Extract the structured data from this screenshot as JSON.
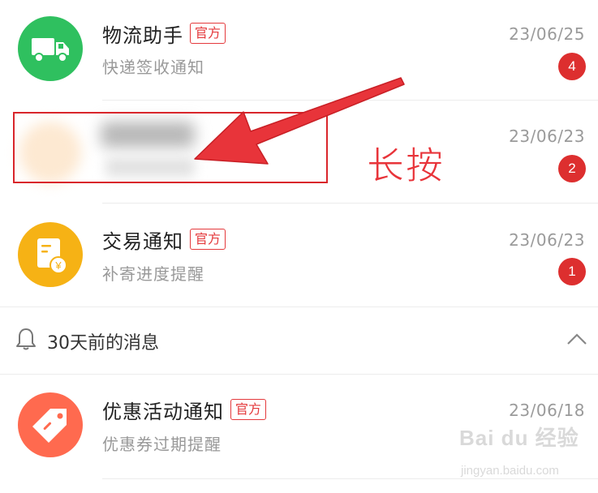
{
  "conversations": [
    {
      "title": "物流助手",
      "tag": "官方",
      "subtitle": "快递签收通知",
      "date": "23/06/25",
      "unread": "4",
      "avatar_icon": "truck-icon",
      "avatar_color": "#2fc05f"
    },
    {
      "title": "",
      "subtitle": "",
      "date": "23/06/23",
      "unread": "2",
      "blurred": true
    },
    {
      "title": "交易通知",
      "tag": "官方",
      "subtitle": "补寄进度提醒",
      "date": "23/06/23",
      "unread": "1",
      "avatar_icon": "receipt-yuan-icon",
      "avatar_color": "#f6b215"
    },
    {
      "title": "优惠活动通知",
      "tag": "官方",
      "subtitle": "优惠券过期提醒",
      "date": "23/06/18",
      "avatar_icon": "price-tag-icon",
      "avatar_color": "#ff6a4f"
    }
  ],
  "older_section": {
    "label": "30天前的消息",
    "icon": "bell-icon",
    "toggle_icon": "chevron-up-icon"
  },
  "annotation": {
    "text": "长按",
    "color": "#e8343a"
  },
  "watermark": {
    "brand": "Bai du 经验",
    "url": "jingyan.baidu.com"
  },
  "colors": {
    "badge_red": "#dd2f2f",
    "official_tag": "#e4393c"
  }
}
